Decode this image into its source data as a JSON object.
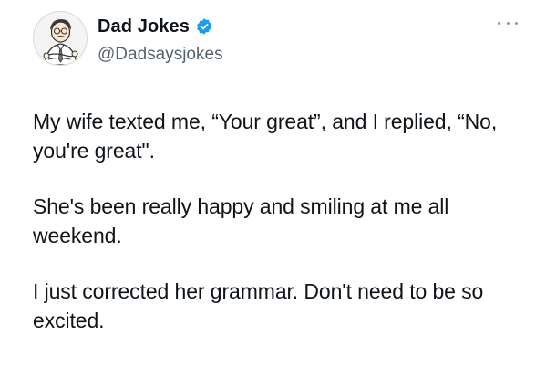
{
  "author": {
    "display_name": "Dad Jokes",
    "handle": "@Dadsaysjokes",
    "verified": true,
    "badge_color": "#1d9bf0",
    "avatar_icon": "cartoon-dad-avatar"
  },
  "menu": {
    "icon": "more-horizontal-icon"
  },
  "tweet": {
    "paragraphs": [
      "My wife texted me, “Your great”, and I replied, “No, you're great\".",
      "She's been really happy and smiling at me all weekend.",
      "I just corrected her grammar. Don't need to be so excited."
    ]
  },
  "colors": {
    "text": "#0f1419",
    "secondary": "#536471",
    "background": "#ffffff"
  }
}
